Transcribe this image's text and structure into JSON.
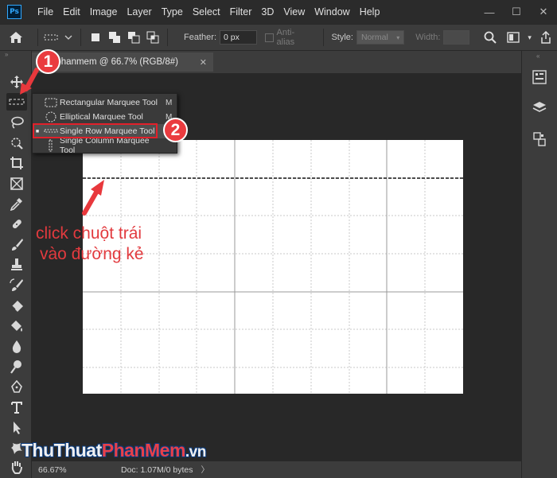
{
  "app": {
    "logo_text": "Ps",
    "menu": [
      "File",
      "Edit",
      "Image",
      "Layer",
      "Type",
      "Select",
      "Filter",
      "3D",
      "View",
      "Window",
      "Help"
    ],
    "window_controls": [
      "—",
      "☐",
      "✕"
    ]
  },
  "options": {
    "feather_label": "Feather:",
    "feather_value": "0 px",
    "antialias_label": "Anti-alias",
    "style_label": "Style:",
    "style_value": "Normal",
    "width_label": "Width:"
  },
  "document": {
    "tab_title": "huatphanmem @ 66.7% (RGB/8#)",
    "tab_close": "✕"
  },
  "flyout": {
    "items": [
      {
        "label": "Rectangular Marquee Tool",
        "shortcut": "M",
        "selected": false
      },
      {
        "label": "Elliptical Marquee Tool",
        "shortcut": "M",
        "selected": false
      },
      {
        "label": "Single Row Marquee Tool",
        "shortcut": "",
        "selected": true
      },
      {
        "label": "Single Column Marquee Tool",
        "shortcut": "",
        "selected": false
      }
    ]
  },
  "annotations": {
    "badge1": "1",
    "badge2": "2",
    "instruction_line1": "click chuột trái",
    "instruction_line2": "vào đường kẻ",
    "accent_color": "#e23a3e"
  },
  "status": {
    "zoom": "66.67%",
    "doc_info": "Doc: 1.07M/0 bytes",
    "arrow": "〉"
  },
  "watermark": {
    "part1": "Thu",
    "part2": "Thuat",
    "part3": "Phan",
    "part4": "Mem",
    "part5": ".vn"
  }
}
